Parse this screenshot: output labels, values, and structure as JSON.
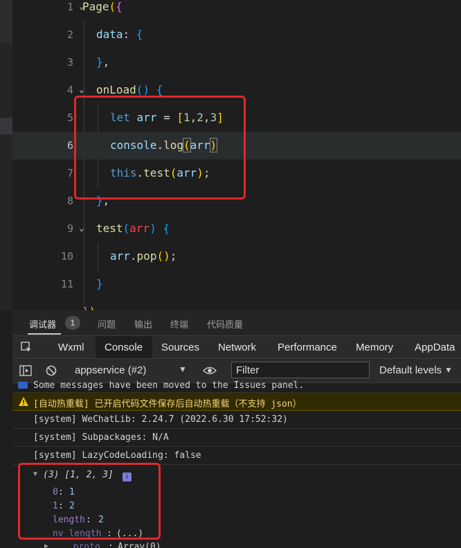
{
  "editor": {
    "lines": [
      {
        "n": "1",
        "code": "Page({"
      },
      {
        "n": "2",
        "code": "data: {"
      },
      {
        "n": "3",
        "code": "},"
      },
      {
        "n": "4",
        "code": "onLoad() {"
      },
      {
        "n": "5",
        "code": "let arr = [1,2,3]"
      },
      {
        "n": "6",
        "code": "console.log(arr)"
      },
      {
        "n": "7",
        "code": "this.test(arr);"
      },
      {
        "n": "8",
        "code": "},"
      },
      {
        "n": "9",
        "code": "test(arr) {"
      },
      {
        "n": "10",
        "code": "arr.pop();"
      },
      {
        "n": "11",
        "code": "}"
      }
    ],
    "active_line": "6"
  },
  "devtools": {
    "top_tabs": [
      "调试器",
      "问题",
      "输出",
      "终端",
      "代码质量"
    ],
    "badge": "1",
    "panel_tabs": [
      "Wxml",
      "Console",
      "Sources",
      "Network",
      "Performance",
      "Memory",
      "AppData"
    ],
    "context": "appservice (#2)",
    "filter_placeholder": "Filter",
    "levels": "Default levels"
  },
  "console": {
    "moved_msg": "Some messages have been moved to the Issues panel.",
    "warn_msg": "[自动热重载] 已开启代码文件保存后自动热重载（不支持 json）",
    "sys1": "[system] WeChatLib: 2.24.7 (2022.6.30 17:52:32)",
    "sys2": "[system] Subpackages: N/A",
    "sys3": "[system] LazyCodeLoading: false",
    "array_summary": "(3) [1, 2, 3]",
    "entries": [
      {
        "key": "0",
        "value": "1"
      },
      {
        "key": "1",
        "value": "2"
      },
      {
        "key": "length",
        "value": "2"
      },
      {
        "key": "nv_length",
        "value": "(...)"
      },
      {
        "key": "__proto__",
        "value": "Array(0)"
      }
    ]
  },
  "colors": {
    "highlight": "#e0282e",
    "accent": "#9a7fd6"
  }
}
